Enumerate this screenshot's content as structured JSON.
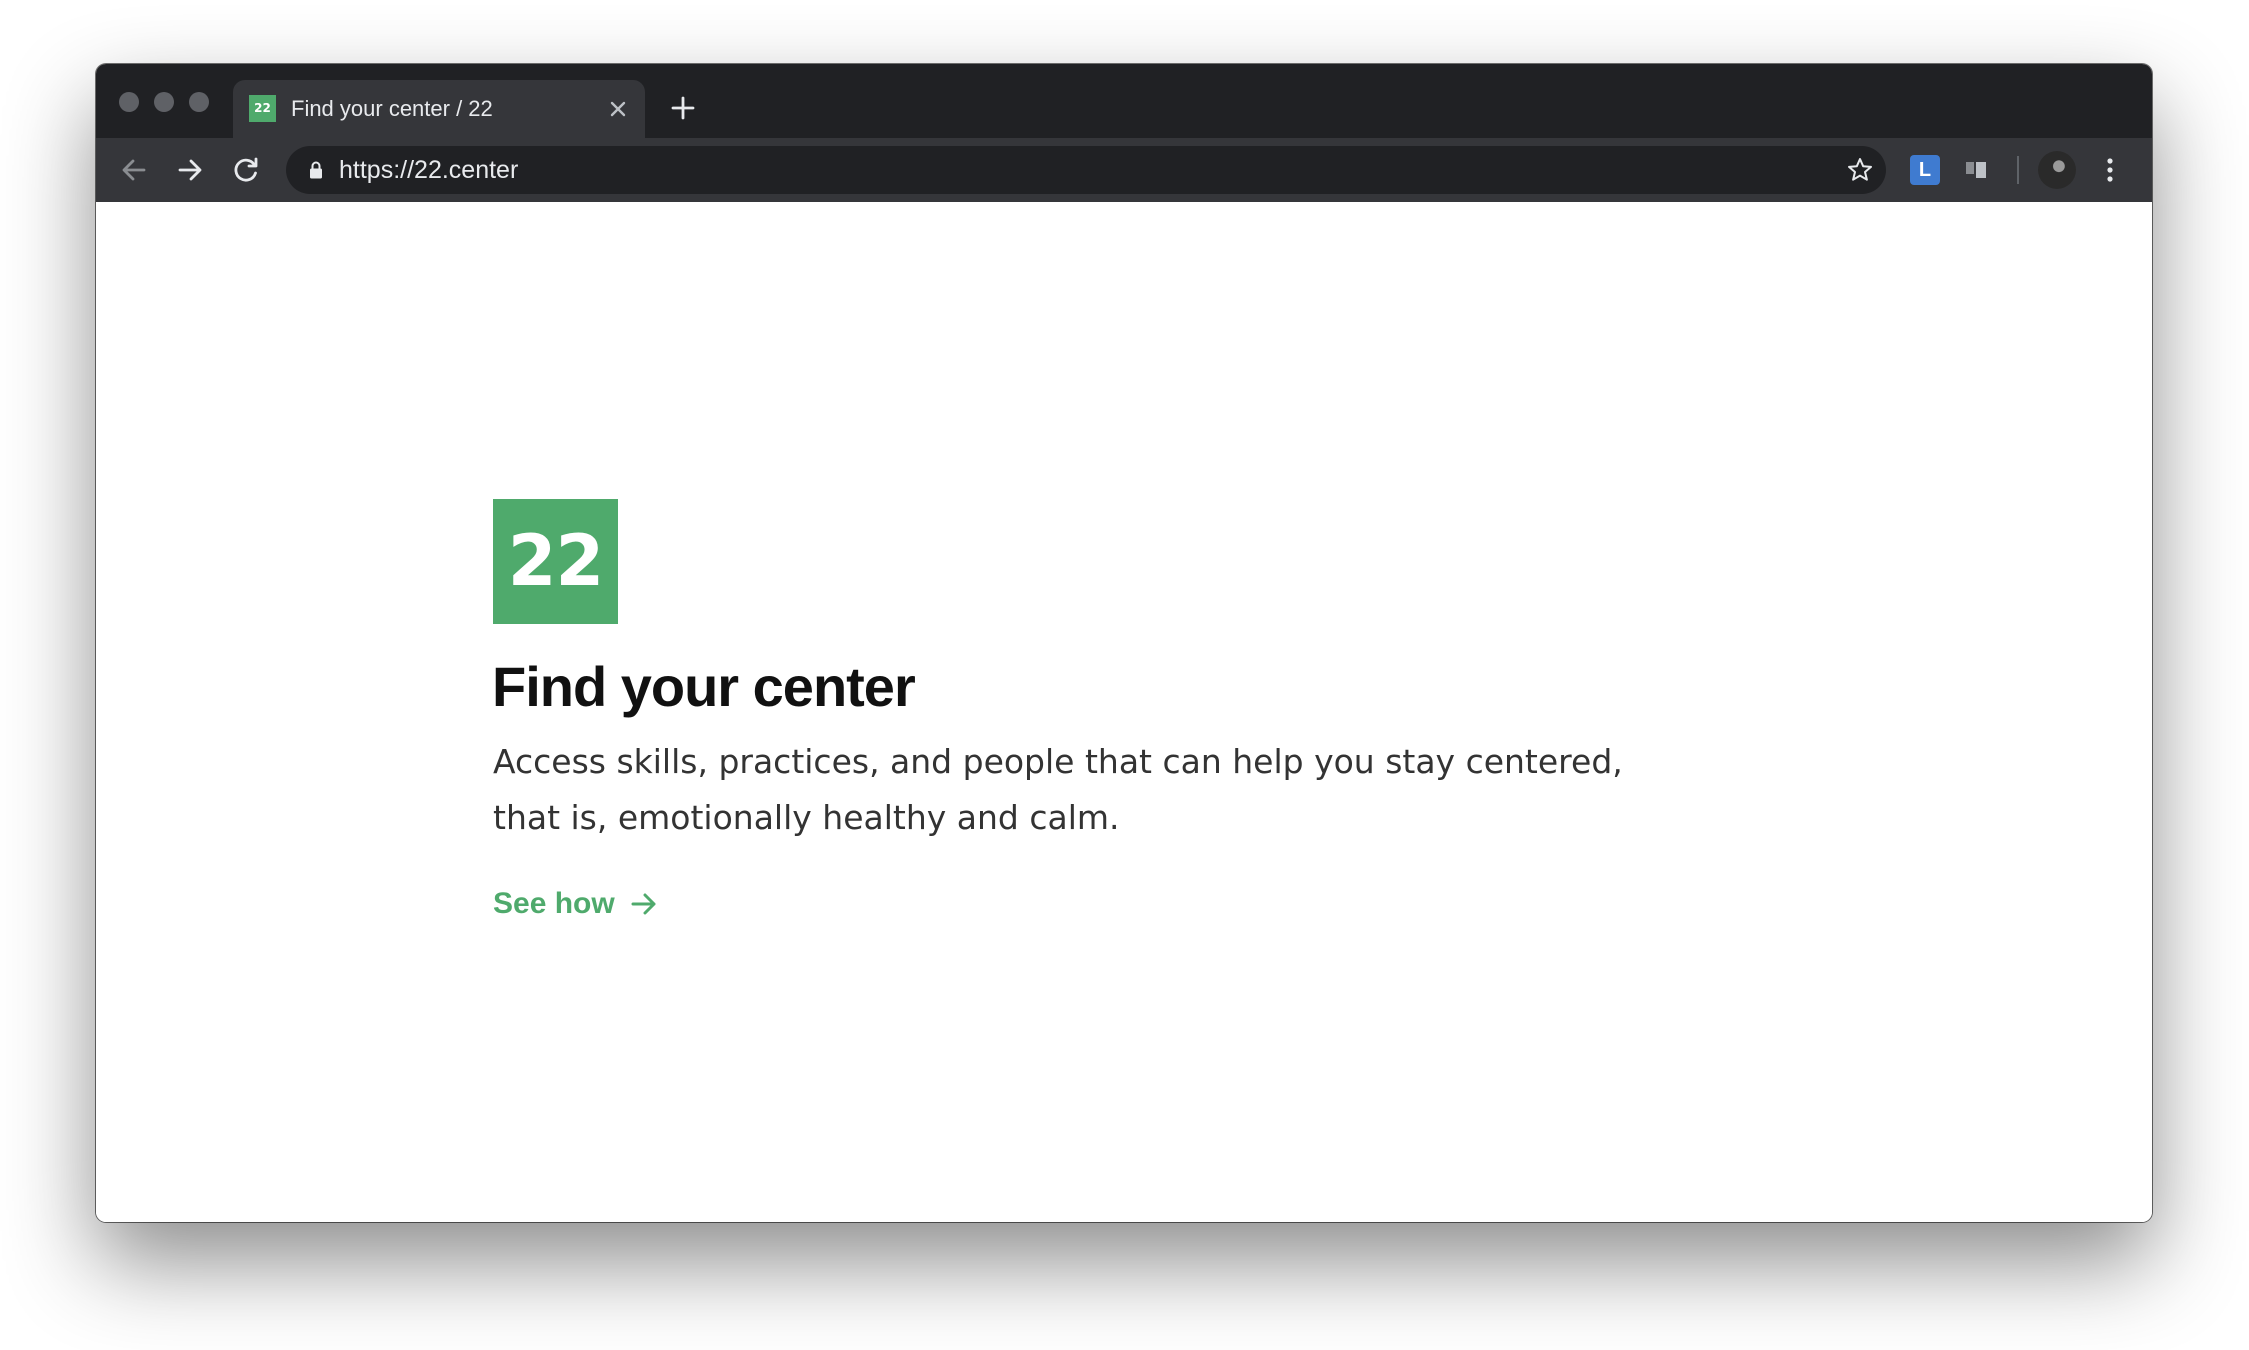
{
  "browser": {
    "tab": {
      "favicon_text": "22",
      "title": "Find your center / 22"
    },
    "toolbar": {
      "url": "https://22.center",
      "extension_badge": "L"
    }
  },
  "page": {
    "logo_text": "22",
    "headline": "Find your center",
    "subtitle": "Access skills, practices, and people that can help you stay centered, that is, emotionally healthy and calm.",
    "cta_label": "See how"
  },
  "icons": {
    "tab_close": "close-icon",
    "new_tab": "plus-icon",
    "back": "arrow-left-icon",
    "forward": "arrow-right-icon",
    "reload": "reload-icon",
    "lock": "lock-icon",
    "bookmark": "star-icon",
    "menu": "kebab-menu-icon",
    "cta": "arrow-right-icon"
  },
  "colors": {
    "brand_green": "#4faa6c",
    "tabstrip_bg": "#202124",
    "toolbar_bg": "#35363a",
    "omnibox_bg": "#202124",
    "extension_blue": "#3f7bd0",
    "page_bg": "#ffffff",
    "headline": "#111111",
    "body_text": "#333333"
  }
}
